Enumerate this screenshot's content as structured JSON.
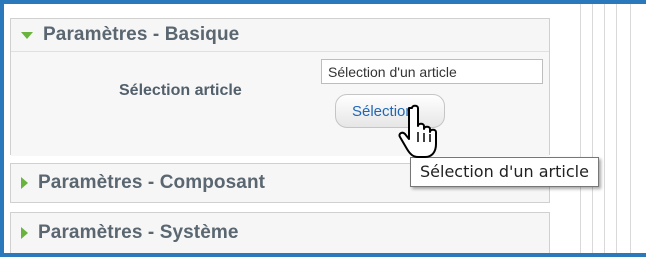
{
  "panels": [
    {
      "title": "Paramètres - Basique",
      "expanded": true
    },
    {
      "title": "Paramètres - Composant",
      "expanded": false
    },
    {
      "title": "Paramètres - Système",
      "expanded": false
    }
  ],
  "basic": {
    "field_label": "Sélection article",
    "input_value": "Sélection d'un article",
    "select_button_label": "Sélection"
  },
  "tooltip": {
    "text": "Sélection d'un article"
  },
  "icons": {
    "expanded_arrow": "triangle-down-icon",
    "collapsed_arrow": "triangle-right-icon",
    "cursor": "hand-pointer-icon"
  },
  "colors": {
    "frame_border": "#2b78bb",
    "arrow": "#6ab33e",
    "panel_title": "#5a6670",
    "button_text": "#1f67b6"
  }
}
